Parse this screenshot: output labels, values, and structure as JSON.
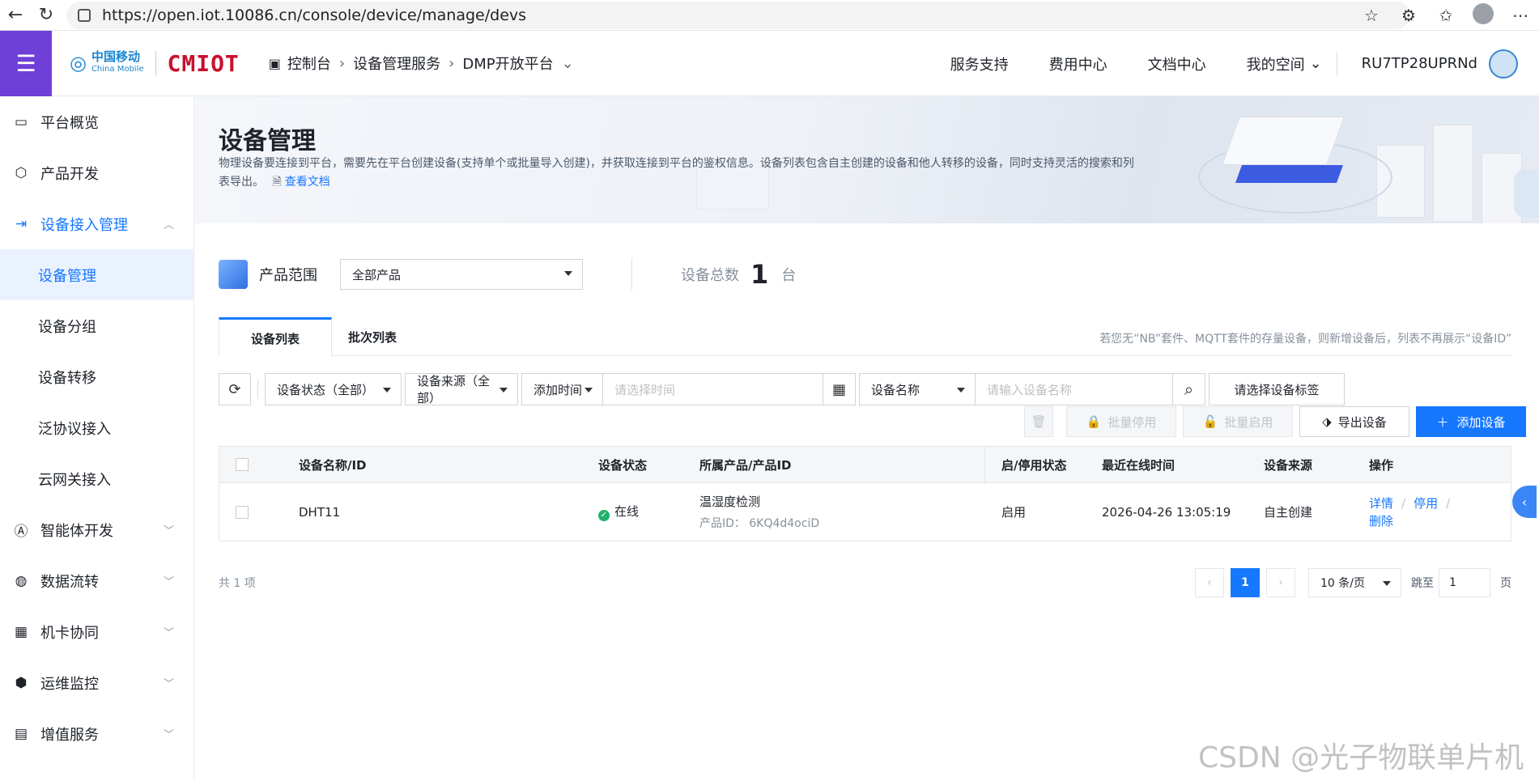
{
  "browser": {
    "url": "https://open.iot.10086.cn/console/device/manage/devs"
  },
  "topnav": {
    "brand_cn": "中国移动",
    "brand_en": "China Mobile",
    "brand_iot": "CMIOT",
    "breadcrumbs": [
      "控制台",
      "设备管理服务",
      "DMP开放平台"
    ],
    "links": [
      "服务支持",
      "费用中心",
      "文档中心",
      "我的空间"
    ],
    "username": "RU7TP28UPRNd"
  },
  "sidebar": {
    "items": [
      {
        "label": "平台概览",
        "icon": "monitor-icon"
      },
      {
        "label": "产品开发",
        "icon": "cube-icon"
      },
      {
        "label": "设备接入管理",
        "icon": "device-access-icon"
      }
    ],
    "sub_items": [
      "设备管理",
      "设备分组",
      "设备转移",
      "泛协议接入",
      "云网关接入"
    ],
    "more_items": [
      {
        "label": "智能体开发",
        "icon": "ai-icon"
      },
      {
        "label": "数据流转",
        "icon": "dataflow-icon"
      },
      {
        "label": "机卡协同",
        "icon": "sim-icon"
      },
      {
        "label": "运维监控",
        "icon": "monitor-ops-icon"
      },
      {
        "label": "增值服务",
        "icon": "chart-icon"
      }
    ]
  },
  "banner": {
    "title": "设备管理",
    "desc": "物理设备要连接到平台，需要先在平台创建设备(支持单个或批量导入创建)，并获取连接到平台的鉴权信息。设备列表包含自主创建的设备和他人转移的设备，同时支持灵活的搜索和列表导出。",
    "doc_link": "查看文档"
  },
  "product": {
    "label": "产品范围",
    "selected": "全部产品",
    "total_label": "设备总数",
    "total": "1",
    "total_unit": "台"
  },
  "tabs": {
    "items": [
      "设备列表",
      "批次列表"
    ],
    "note": "若您无“NB”套件、MQTT套件的存量设备，则新增设备后，列表不再展示“设备ID”"
  },
  "filter": {
    "status": "设备状态（全部）",
    "source": "设备来源（全部）",
    "time_field": "添加时间",
    "time_placeholder": "请选择时间",
    "name_field": "设备名称",
    "name_placeholder": "请输入设备名称",
    "tag_button": "请选择设备标签"
  },
  "actions": {
    "batch_disable": "批量停用",
    "batch_enable": "批量启用",
    "export": "导出设备",
    "add": "添加设备"
  },
  "table": {
    "headers": [
      "设备名称/ID",
      "设备状态",
      "所属产品/产品ID",
      "启/停用状态",
      "最近在线时间",
      "设备来源",
      "操作"
    ],
    "rows": [
      {
        "name": "DHT11",
        "status": "在线",
        "product": "温湿度检测",
        "product_id_label": "产品ID：",
        "product_id": "6KQ4d4ociD",
        "enabled": "启用",
        "last_online": "2026-04-26 13:05:19",
        "source": "自主创建",
        "op_detail": "详情",
        "op_disable": "停用",
        "op_delete": "删除"
      }
    ]
  },
  "footer": {
    "count": "共 1 项",
    "current_page": "1",
    "page_size": "10 条/页",
    "jump_label": "跳至",
    "jump_value": "1",
    "page_unit": "页"
  },
  "watermark": "CSDN @光子物联单片机"
}
